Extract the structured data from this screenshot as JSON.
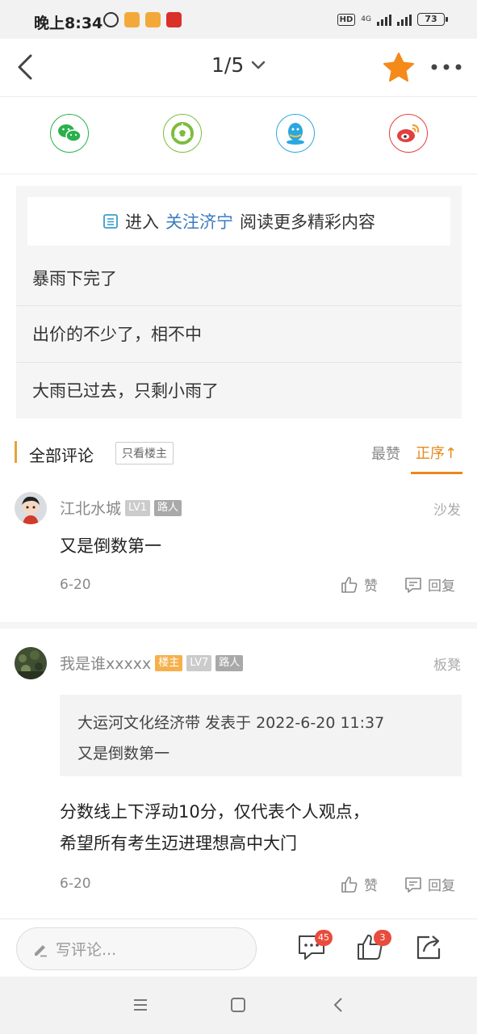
{
  "status_bar": {
    "time": "晚上8:34",
    "hd": "HD",
    "network": "4G",
    "battery": "73"
  },
  "nav": {
    "page_indicator": "1/5"
  },
  "share": {
    "items": [
      "wechat-icon",
      "moments-icon",
      "qq-icon",
      "weibo-icon"
    ],
    "colors": [
      "#2ab14c",
      "#7cbd3b",
      "#2aa7e0",
      "#e2403f"
    ]
  },
  "card": {
    "banner_prefix": "进入",
    "banner_link": "关注济宁",
    "banner_suffix": "阅读更多精彩内容",
    "lines": [
      "暴雨下完了",
      "出价的不少了，相不中",
      "大雨已过去，只剩小雨了"
    ]
  },
  "comments_header": {
    "title": "全部评论",
    "only_owner": "只看楼主",
    "sort_best": "最赞",
    "sort_order": "正序↑"
  },
  "comments": [
    {
      "name": "江北水城",
      "level": "LV1",
      "role": "路人",
      "floor": "沙发",
      "text": "又是倒数第一",
      "date": "6-20",
      "like_label": "赞",
      "reply_label": "回复"
    },
    {
      "name": "我是谁xxxxx",
      "owner_tag": "楼主",
      "level": "LV7",
      "role": "路人",
      "floor": "板凳",
      "quote_header": "大运河文化经济带 发表于 2022-6-20 11:37",
      "quote_text": "又是倒数第一",
      "text_line1": "分数线上下浮动10分，仅代表个人观点，",
      "text_line2": "希望所有考生迈进理想高中大门",
      "date": "6-20",
      "like_label": "赞",
      "reply_label": "回复"
    }
  ],
  "bottom_bar": {
    "input_placeholder": "写评论...",
    "comment_count": "45",
    "like_count": "3"
  },
  "colors": {
    "accent": "#e8891c",
    "link": "#3a7bbf",
    "badge": "#e94b3c"
  }
}
